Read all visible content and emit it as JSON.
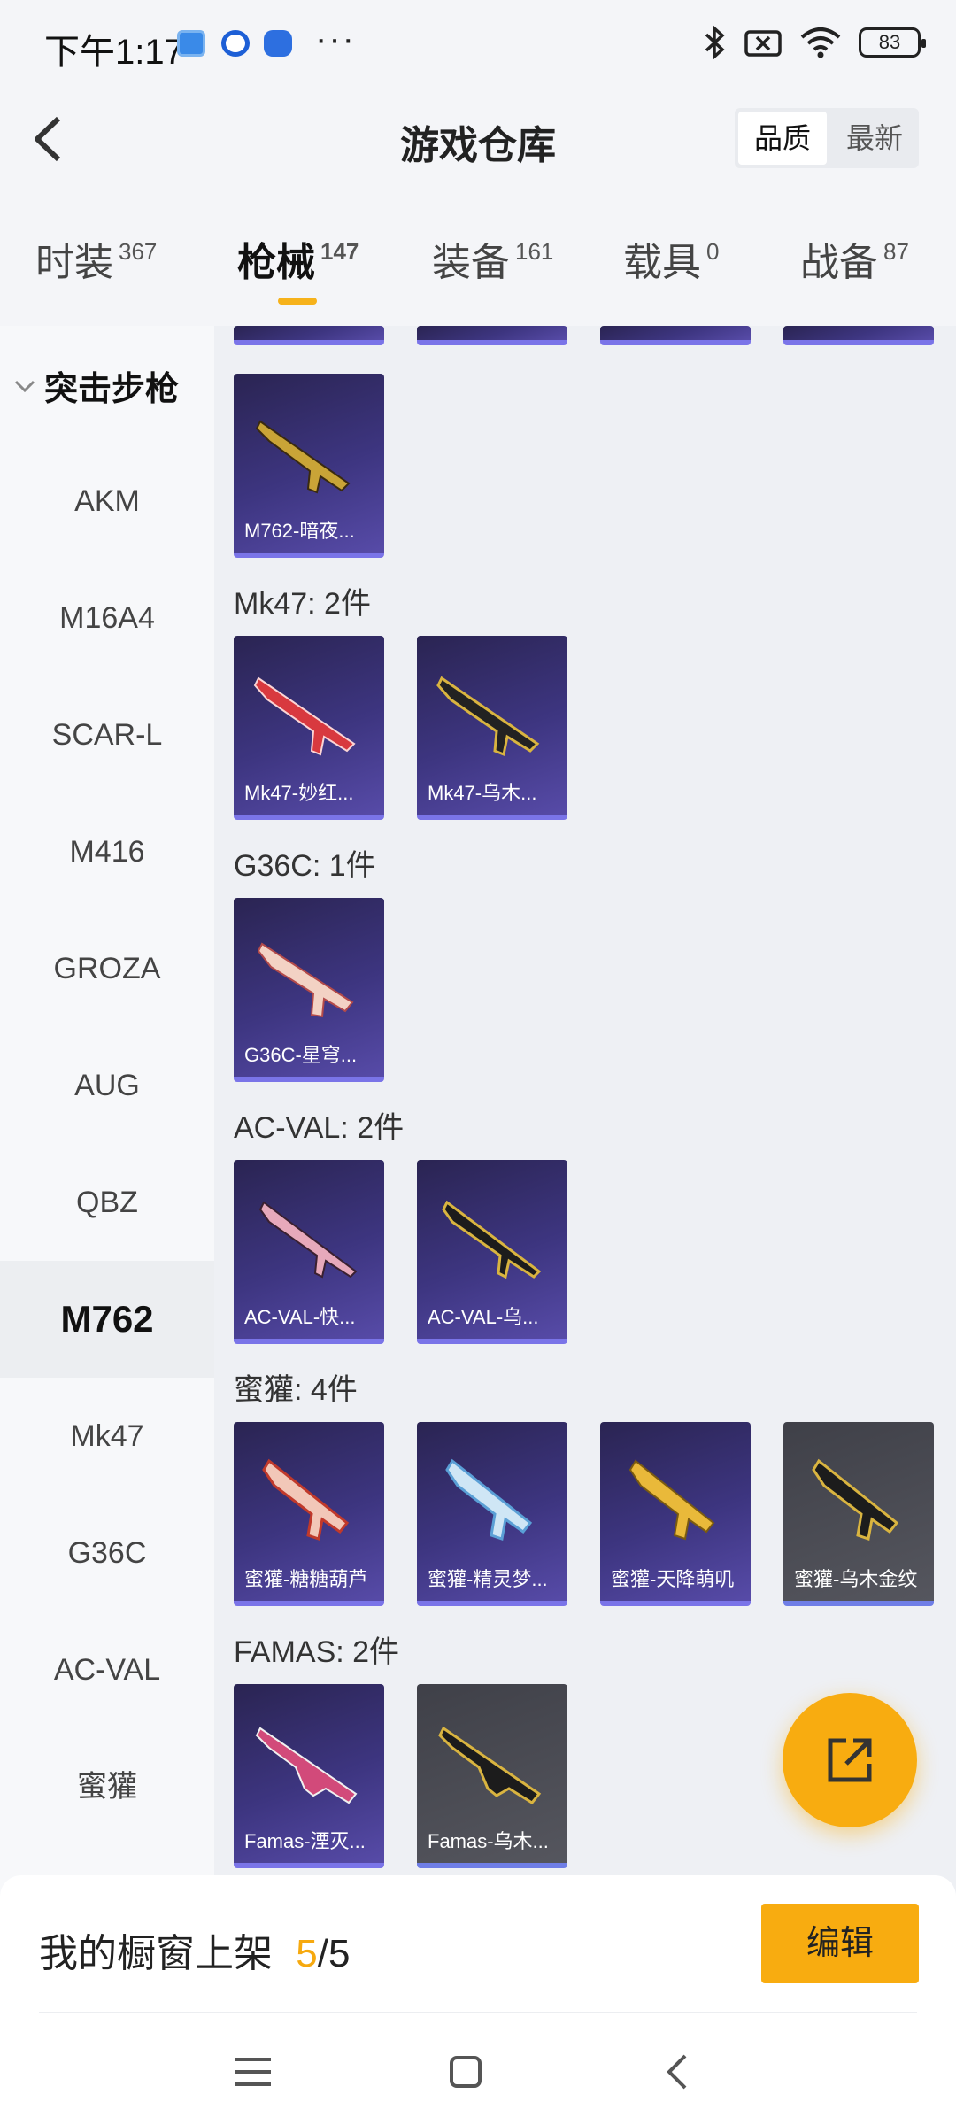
{
  "status_bar": {
    "time": "下午1:17",
    "dots": "···",
    "battery": "83",
    "icons": [
      "sim-card-icon",
      "app-notification-icon",
      "baidu-icon",
      "bluetooth-icon",
      "no-signal-icon",
      "wifi-icon",
      "battery-icon"
    ]
  },
  "header": {
    "title": "游戏仓库",
    "sort_options": [
      "品质",
      "最新"
    ],
    "sort_selected": "品质"
  },
  "tabs": [
    {
      "label": "时装",
      "count": "367"
    },
    {
      "label": "枪械",
      "count": "147",
      "active": true
    },
    {
      "label": "装备",
      "count": "161"
    },
    {
      "label": "载具",
      "count": "0"
    },
    {
      "label": "战备",
      "count": "87"
    }
  ],
  "sidebar": {
    "category": "突击步枪",
    "items": [
      "AKM",
      "M16A4",
      "SCAR-L",
      "M416",
      "GROZA",
      "AUG",
      "QBZ",
      "M762",
      "Mk47",
      "G36C",
      "AC-VAL",
      "蜜獾"
    ],
    "active": "M762"
  },
  "content": {
    "top_card": {
      "label": "M762-暗夜..."
    },
    "groups": [
      {
        "title": "Mk47: 2件",
        "cards": [
          "Mk47-妙红...",
          "Mk47-乌木..."
        ]
      },
      {
        "title": "G36C: 1件",
        "cards": [
          "G36C-星穹..."
        ]
      },
      {
        "title": "AC-VAL: 2件",
        "cards": [
          "AC-VAL-快...",
          "AC-VAL-乌..."
        ]
      },
      {
        "title": "蜜獾: 4件",
        "cards": [
          "蜜獾-糖糖葫芦",
          "蜜獾-精灵梦...",
          "蜜獾-天降萌叽",
          "蜜獾-乌木金纹"
        ]
      },
      {
        "title": "FAMAS: 2件",
        "cards": [
          "Famas-湮灭...",
          "Famas-乌木..."
        ]
      }
    ],
    "colors": {
      "accent": "#f8ac10",
      "card_purple": "#3d3580",
      "card_gray": "#55565e"
    }
  },
  "bottom": {
    "showcase_label": "我的橱窗上架",
    "showcase_current": "5",
    "showcase_sep": "/",
    "showcase_total": "5",
    "edit_label": "编辑"
  }
}
